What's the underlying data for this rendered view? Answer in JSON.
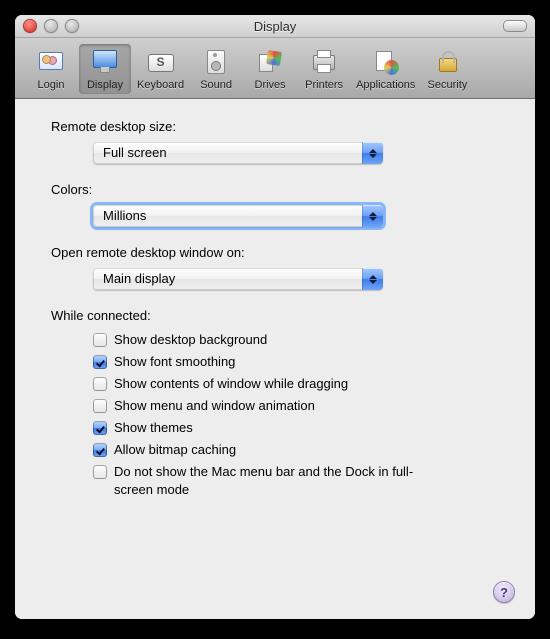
{
  "window": {
    "title": "Display"
  },
  "toolbar": {
    "items": [
      {
        "label": "Login",
        "name": "login-tab",
        "icon": "login-icon",
        "selected": false
      },
      {
        "label": "Display",
        "name": "display-tab",
        "icon": "display-icon",
        "selected": true
      },
      {
        "label": "Keyboard",
        "name": "keyboard-tab",
        "icon": "keyboard-icon",
        "selected": false
      },
      {
        "label": "Sound",
        "name": "sound-tab",
        "icon": "sound-icon",
        "selected": false
      },
      {
        "label": "Drives",
        "name": "drives-tab",
        "icon": "drives-icon",
        "selected": false
      },
      {
        "label": "Printers",
        "name": "printers-tab",
        "icon": "printers-icon",
        "selected": false
      },
      {
        "label": "Applications",
        "name": "applications-tab",
        "icon": "applications-icon",
        "selected": false
      },
      {
        "label": "Security",
        "name": "security-tab",
        "icon": "security-icon",
        "selected": false
      }
    ]
  },
  "sections": {
    "remote_size": {
      "label": "Remote desktop size:",
      "value": "Full screen"
    },
    "colors": {
      "label": "Colors:",
      "value": "Millions",
      "focused": true
    },
    "open_on": {
      "label": "Open remote desktop window on:",
      "value": "Main display"
    },
    "while_connected": {
      "label": "While connected:",
      "options": [
        {
          "label": "Show desktop background",
          "checked": false
        },
        {
          "label": "Show font smoothing",
          "checked": true
        },
        {
          "label": "Show contents of window while dragging",
          "checked": false
        },
        {
          "label": "Show menu and window animation",
          "checked": false
        },
        {
          "label": "Show themes",
          "checked": true
        },
        {
          "label": "Allow bitmap caching",
          "checked": true
        },
        {
          "label": "Do not show the Mac menu bar and the Dock in full-screen mode",
          "checked": false
        }
      ]
    }
  },
  "help_glyph": "?"
}
